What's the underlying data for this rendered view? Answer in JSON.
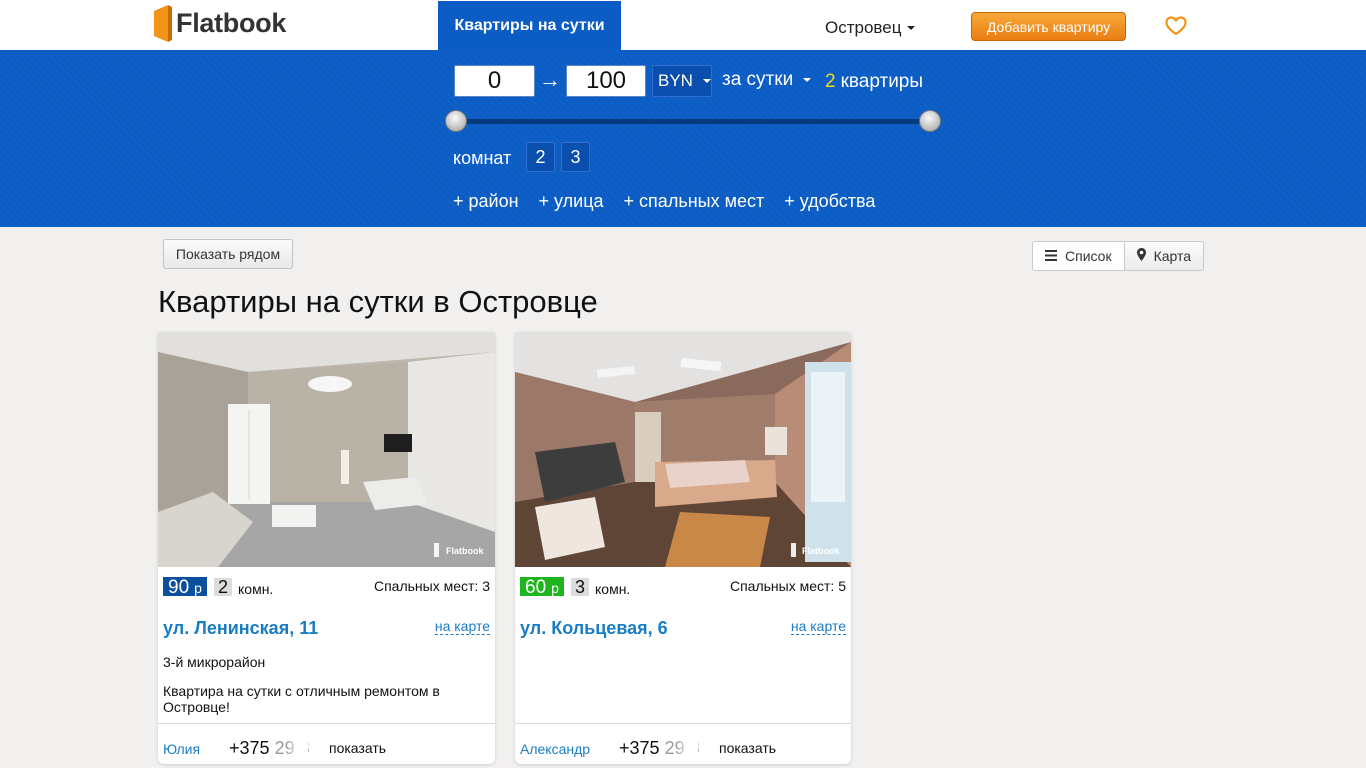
{
  "header": {
    "logo_text": "Flatbook",
    "nav_tab": "Квартиры на сутки",
    "city": "Островец",
    "add_button": "Добавить квартиру"
  },
  "filter": {
    "price_from": "0",
    "price_to": "100",
    "arrow": "→",
    "currency": "BYN",
    "period": "за сутки",
    "count_number": "2",
    "count_label": "квартиры",
    "price_range": {
      "min": 0,
      "max": 100
    },
    "rooms_label": "комнат",
    "rooms": [
      "2",
      "3"
    ],
    "links": [
      "+ район",
      "+ улица",
      "+ спальных мест",
      "+ удобства"
    ]
  },
  "toolbar": {
    "show_near": "Показать рядом",
    "list_label": "Список",
    "map_label": "Карта"
  },
  "page_title": "Квартиры на сутки в Островце",
  "listings": [
    {
      "price": "90",
      "price_currency": "р",
      "price_color": "#0b4f9e",
      "rooms": "2",
      "rooms_word": "комн.",
      "beds": "Спальных мест: 3",
      "street": "ул. Ленинская, 11",
      "on_map": "на карте",
      "district": "3-й микрорайон",
      "description": "Квартира на сутки с отличным ремонтом в Островце!",
      "owner": "Юлия",
      "phone_visible": "+375",
      "phone_hidden": "29 3",
      "show_phone": "показать",
      "watermark": "Flatbook"
    },
    {
      "price": "60",
      "price_currency": "р",
      "price_color": "#1fb51f",
      "rooms": "3",
      "rooms_word": "комн.",
      "beds": "Спальных мест: 5",
      "street": "ул. Кольцевая, 6",
      "on_map": "на карте",
      "district": "",
      "description": "",
      "owner": "Александр",
      "phone_visible": "+375",
      "phone_hidden": "29 3",
      "show_phone": "показать",
      "watermark": "Flatbook"
    }
  ],
  "icons": {
    "logo": "door-icon",
    "favorites": "heart-icon",
    "list_view": "list-icon",
    "map_view": "map-marker-icon"
  },
  "colors": {
    "brand_blue": "#0b5cc4",
    "accent_orange": "#ea7d12",
    "link_blue": "#1a7dc4",
    "count_yellow": "#f6d71b"
  }
}
